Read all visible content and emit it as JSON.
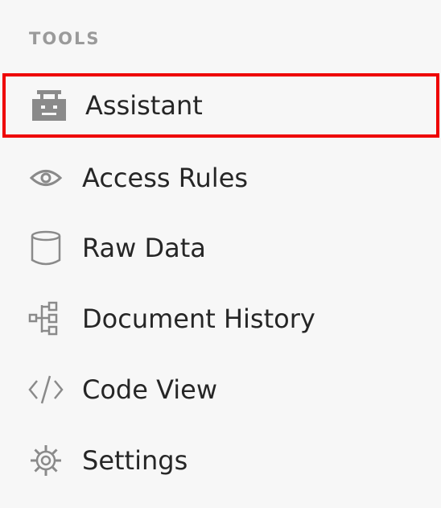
{
  "sidebar": {
    "section_title": "TOOLS",
    "items": [
      {
        "label": "Assistant",
        "icon": "assistant-robot-icon",
        "selected": true
      },
      {
        "label": "Access Rules",
        "icon": "eye-icon",
        "selected": false
      },
      {
        "label": "Raw Data",
        "icon": "database-icon",
        "selected": false
      },
      {
        "label": "Document History",
        "icon": "history-tree-icon",
        "selected": false
      },
      {
        "label": "Code View",
        "icon": "code-icon",
        "selected": false
      },
      {
        "label": "Settings",
        "icon": "gear-icon",
        "selected": false
      }
    ]
  },
  "colors": {
    "background": "#f7f7f7",
    "section_title": "#9a9a9a",
    "icon": "#8a8a8a",
    "text": "#262626",
    "selection_border": "#ee0000"
  }
}
